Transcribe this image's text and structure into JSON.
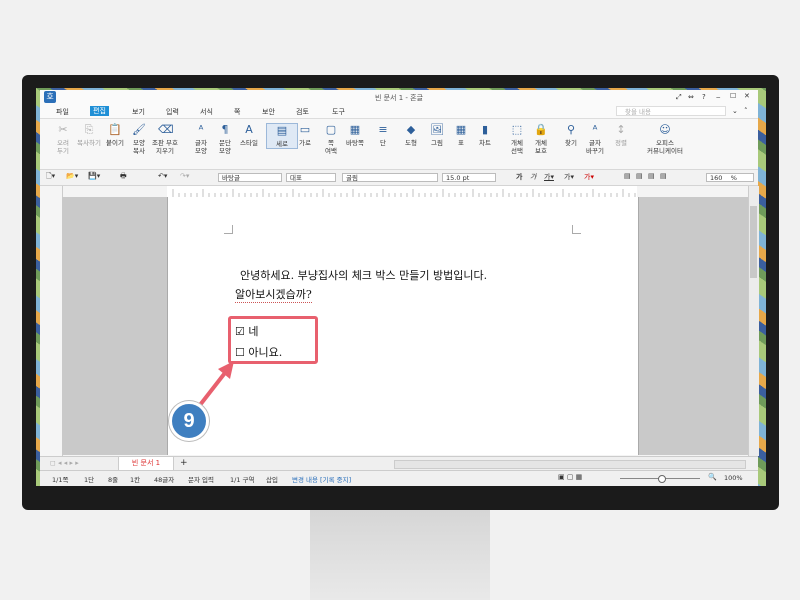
{
  "colors": {
    "accent": "#e8606e",
    "marker_bg": "#3f7fc0",
    "active_menu": "#1f8fd6"
  },
  "window": {
    "title": "빈 문서 1 - 혼글",
    "app_icon": "hwp-app-icon",
    "help": "?",
    "search_placeholder": "찾을 내용"
  },
  "menu": [
    "파일",
    "편집",
    "보기",
    "입력",
    "서식",
    "쪽",
    "보안",
    "검토",
    "도구"
  ],
  "ribbon": [
    {
      "label": "오려\n두기",
      "icon": "scissors-icon",
      "dim": true
    },
    {
      "label": "복사하기",
      "icon": "copy-icon",
      "dim": true
    },
    {
      "label": "붙이기",
      "icon": "paste-icon",
      "dim": false
    },
    {
      "label": "모양\n복사",
      "icon": "format-painter-icon",
      "dim": false
    },
    {
      "label": "조판 부호\n지우기",
      "icon": "clear-markup-icon",
      "dim": false
    },
    {
      "label": "글자\n모양",
      "icon": "char-shape-icon",
      "dim": false
    },
    {
      "label": "문단\n모양",
      "icon": "para-shape-icon",
      "dim": false
    },
    {
      "label": "스타일",
      "icon": "style-icon",
      "dim": false
    },
    {
      "label": "세로",
      "icon": "portrait-icon",
      "dim": false
    },
    {
      "label": "가로",
      "icon": "landscape-icon",
      "dim": false
    },
    {
      "label": "쪽\n여백",
      "icon": "margin-icon",
      "dim": false
    },
    {
      "label": "바탕쪽",
      "icon": "master-page-icon",
      "dim": false
    },
    {
      "label": "단",
      "icon": "columns-icon",
      "dim": false
    },
    {
      "label": "도형",
      "icon": "shape-icon",
      "dim": false
    },
    {
      "label": "그림",
      "icon": "picture-icon",
      "dim": false
    },
    {
      "label": "표",
      "icon": "table-icon",
      "dim": false
    },
    {
      "label": "차트",
      "icon": "chart-icon",
      "dim": false
    },
    {
      "label": "개체\n선택",
      "icon": "select-object-icon",
      "dim": false
    },
    {
      "label": "개체\n보호",
      "icon": "protect-object-icon",
      "dim": false
    },
    {
      "label": "찾기",
      "icon": "binoculars-icon",
      "dim": false
    },
    {
      "label": "글자\n바꾸기",
      "icon": "replace-icon",
      "dim": false
    },
    {
      "label": "정렬",
      "icon": "sort-icon",
      "dim": true
    },
    {
      "label": "오피스\n커뮤니케이터",
      "icon": "communicator-icon",
      "dim": false
    }
  ],
  "toolbar": {
    "style": "바탕글",
    "lang": "대표",
    "font": "굴림",
    "size": "15.0",
    "unit": "pt",
    "zoom": "160",
    "zoom_unit": "%"
  },
  "document": {
    "line1": "안녕하세요. 부냥집사의 체크 박스 만들기 방법입니다.",
    "line2": "알아보시겠습까?",
    "check1_box": "☑",
    "check1_text": "네",
    "check2_box": "☐",
    "check2_text": "아니요."
  },
  "marker": {
    "number": "9"
  },
  "tabs": {
    "active": "빈 문서 1",
    "add": "+"
  },
  "status": [
    "1/1쪽",
    "1단",
    "8줄",
    "1칸",
    "48글자",
    "문자 입력",
    "1/1 구역",
    "삽입",
    "변경 내용 [기록 중지]"
  ],
  "status_zoom": "100%"
}
